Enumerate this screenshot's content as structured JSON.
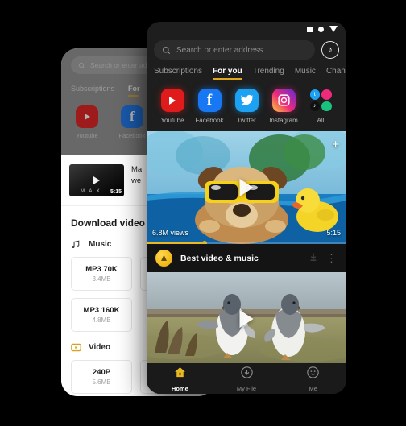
{
  "back_panel": {
    "search": {
      "placeholder": "Search or enter address",
      "icon": "search-icon"
    },
    "tabs": [
      {
        "label": "Subscriptions",
        "active": false
      },
      {
        "label": "For",
        "active": true
      }
    ],
    "apps": [
      {
        "label": "Youtube",
        "icon": "youtube-icon",
        "color": "#e01b1b"
      },
      {
        "label": "Facebook",
        "icon": "facebook-icon",
        "color": "#1877f2"
      }
    ],
    "video": {
      "title_line1": "Ma",
      "title_line2": "we",
      "duration": "5:15",
      "watermark": "M A X"
    },
    "sheet": {
      "heading": "Download video as",
      "sections": [
        {
          "label": "Music",
          "icon": "music-note-icon",
          "options": [
            {
              "name": "MP3 70K",
              "size": "3.4MB"
            },
            {
              "name": "MP3 160K",
              "size": "4.8MB"
            }
          ]
        },
        {
          "label": "Video",
          "icon": "video-badge-icon",
          "options": [
            {
              "name": "240P",
              "size": "5.6MB"
            }
          ]
        }
      ]
    }
  },
  "front_panel": {
    "statusbar": {
      "icons": [
        "square-icon",
        "circle-icon",
        "triangle-down-icon"
      ]
    },
    "search": {
      "placeholder": "Search or enter address",
      "icon": "search-icon"
    },
    "note_button": {
      "icon": "music-note-circle-icon",
      "glyph": "♪"
    },
    "tabs": [
      {
        "label": "Subscriptions",
        "active": false
      },
      {
        "label": "For you",
        "active": true
      },
      {
        "label": "Trending",
        "active": false
      },
      {
        "label": "Music",
        "active": false
      },
      {
        "label": "Chan",
        "active": false
      }
    ],
    "apps": [
      {
        "label": "Youtube",
        "icon": "youtube-icon"
      },
      {
        "label": "Facebook",
        "icon": "facebook-icon"
      },
      {
        "label": "Twitter",
        "icon": "twitter-icon"
      },
      {
        "label": "Instagram",
        "icon": "instagram-icon"
      },
      {
        "label": "All",
        "icon": "all-apps-icon"
      }
    ],
    "video1": {
      "views": "6.8M views",
      "duration": "5:15",
      "play_icon": "play-icon",
      "add_icon": "plus-icon",
      "progress_percent": 29,
      "description": "dog with yellow sunglasses in blue pool with rubber duck"
    },
    "best_row": {
      "title": "Best video & music",
      "download_icon": "download-icon",
      "menu_icon": "more-vertical-icon"
    },
    "video2": {
      "play_icon": "play-icon",
      "description": "two penguins walking on grass"
    },
    "bottom_nav": [
      {
        "label": "Home",
        "icon": "home-icon",
        "active": true
      },
      {
        "label": "My File",
        "icon": "download-circle-icon",
        "active": false
      },
      {
        "label": "Me",
        "icon": "smiley-icon",
        "active": false
      }
    ]
  },
  "colors": {
    "accent": "#e0a81f",
    "bg": "#000000",
    "panel": "#1e1e1e"
  }
}
